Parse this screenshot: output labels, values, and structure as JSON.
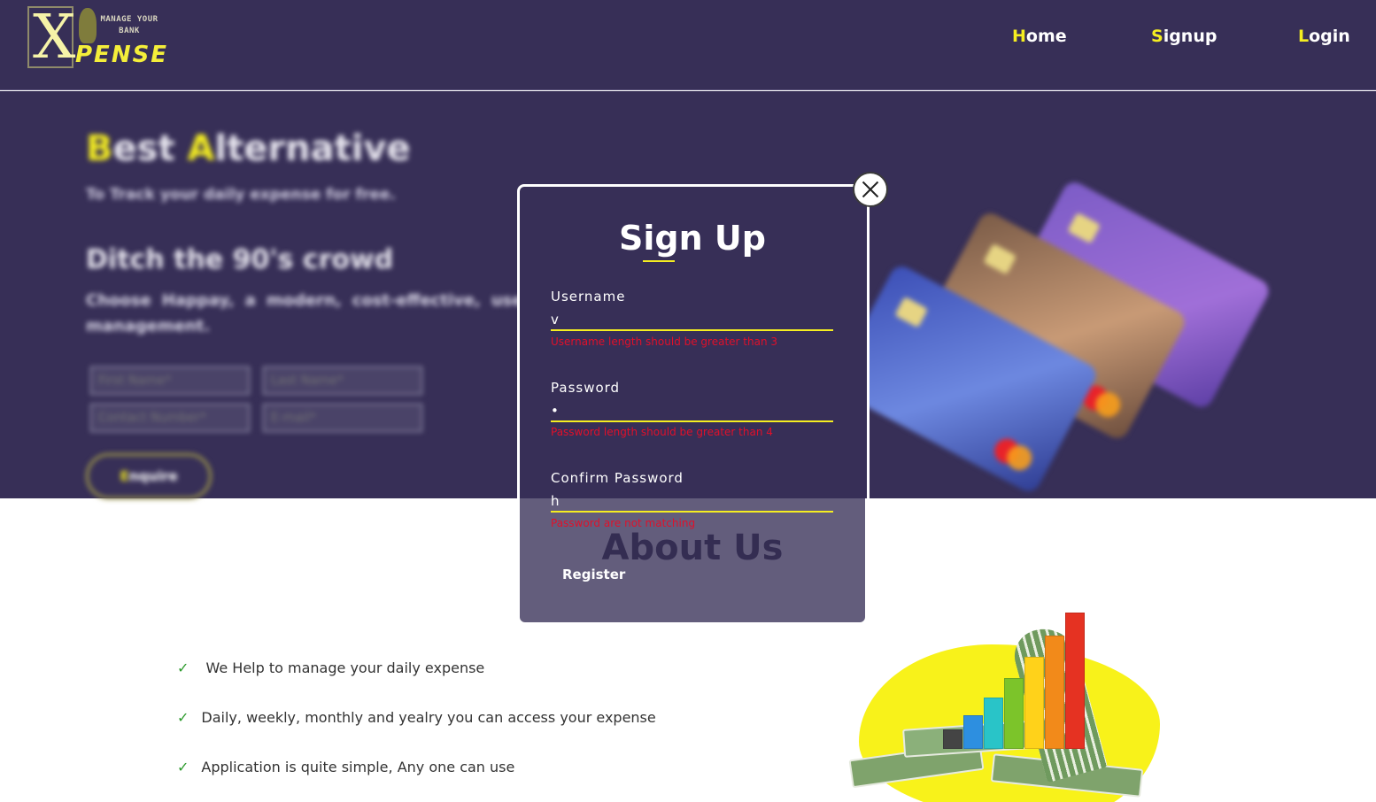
{
  "logo": {
    "letter": "X",
    "tagline": "MANAGE YOUR BANK",
    "wordmark": "PENSE"
  },
  "nav": {
    "home": {
      "first": "H",
      "rest": "ome"
    },
    "signup": {
      "first": "S",
      "rest": "ignup"
    },
    "login": {
      "first": "L",
      "rest": "ogin"
    }
  },
  "hero": {
    "title": {
      "b": "B",
      "est": "est ",
      "a": "A",
      "lternative": "lternative"
    },
    "subtitle": "To Track your daily expense for free.",
    "heading": "Ditch the 90's crowd",
    "paragraph": "Choose Happay, a modern, cost-effective, user friendly expense management.",
    "form": {
      "first_name_placeholder": "First Name*",
      "last_name_placeholder": "Last Name*",
      "contact_placeholder": "Contact Number*",
      "email_placeholder": "E-mail*"
    },
    "button": {
      "first": "E",
      "rest": "nquire"
    }
  },
  "about": {
    "title": "About Us",
    "tick": "✓",
    "items": [
      " We Help to manage your daily expense",
      "Daily, weekly, monthly and yealry you can access your expense",
      "Application is quite simple, Any one can use"
    ]
  },
  "modal": {
    "title": "Sign Up",
    "username": {
      "label": "Username",
      "value": "v",
      "error": "Username length should be greater than 3"
    },
    "password": {
      "label": "Password",
      "value": "•",
      "error": "Password length should be greater than 4"
    },
    "confirm": {
      "label": "Confirm Password",
      "value": "h",
      "error": "Password are not matching"
    },
    "register_label": "Register"
  },
  "colors": {
    "navy": "#372f57",
    "accent": "#f5ee21",
    "error": "#e0102a"
  }
}
